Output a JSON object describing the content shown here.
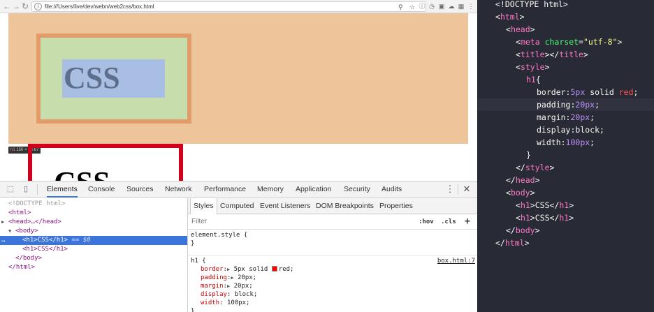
{
  "browser": {
    "url": "file:///Users/live/dev/webn/web2css/box.html",
    "nav": {
      "back": "←",
      "forward": "→",
      "reload": "↻"
    },
    "omnibox_icons": [
      "zoom-icon",
      "star-icon"
    ],
    "toolbar_icons": [
      "info-icon",
      "history-icon",
      "extension-icon",
      "cloud-icon",
      "bookmark-icon",
      "menu-icon"
    ],
    "page": {
      "h1_first": "CSS",
      "h1_second": "CSS",
      "tooltip_tag": "h1",
      "tooltip_dims": "150 × 86.67",
      "colors": {
        "margin": "#eec59a",
        "border": "#e39b6a",
        "padding": "#c7ddab",
        "content": "#a9bee3",
        "h1_border": "#d0021b"
      }
    }
  },
  "devtools": {
    "tabs": [
      "Elements",
      "Console",
      "Sources",
      "Network",
      "Performance",
      "Memory",
      "Application",
      "Security",
      "Audits"
    ],
    "active_tab": "Elements",
    "dom": {
      "doctype": "<!DOCTYPE html>",
      "html_open": "<html>",
      "head": "<head>…</head>",
      "body_open": "<body>",
      "h1_selected_open": "<h1>",
      "h1_selected_text": "CSS",
      "h1_selected_close": "</h1>",
      "selected_marker": "== $0",
      "h1_second": "<h1>CSS</h1>",
      "body_close": "</body>",
      "html_close": "</html>",
      "dots": "…"
    },
    "styles": {
      "tabs": [
        "Styles",
        "Computed",
        "Event Listeners",
        "DOM Breakpoints",
        "Properties"
      ],
      "active_tab": "Styles",
      "filter_placeholder": "Filter",
      "hov": ":hov",
      "cls": ".cls",
      "add": "+",
      "element_style_open": "element.style {",
      "element_style_close": "}",
      "rule_selector": "h1 {",
      "rule_source": "box.html:7",
      "rule_close": "}",
      "declarations": [
        {
          "prop": "border",
          "value": "5px solid",
          "value2": "red;",
          "expandable": true,
          "swatch": true
        },
        {
          "prop": "padding",
          "value": "20px;",
          "expandable": true,
          "swatch": false
        },
        {
          "prop": "margin",
          "value": "20px;",
          "expandable": true,
          "swatch": false
        },
        {
          "prop": "display",
          "value": "block;",
          "expandable": false,
          "swatch": false
        },
        {
          "prop": "width",
          "value": "100px;",
          "expandable": false,
          "swatch": false
        }
      ]
    }
  },
  "editor": {
    "lines": {
      "l1": "<!DOCTYPE html>",
      "l2_tag": "html",
      "l3_tag": "head",
      "l4_tag": "meta",
      "l4_attr": "charset",
      "l4_val": "\"utf-8\"",
      "l5_tag": "title",
      "l5_close": "title",
      "l6_tag": "style",
      "l7_sel": "h1",
      "l7_brace": "{",
      "l8_prop": "border:",
      "l8_num": "5px",
      "l8_rest": "solid",
      "l8_kw": "red",
      "l9_prop": "padding:",
      "l9_num": "20px",
      "l10_prop": "margin:",
      "l10_num": "20px",
      "l11_prop": "display:",
      "l11_val": "block;",
      "l12_prop": "width:",
      "l12_num": "100px",
      "l13": "}",
      "l14_tag": "style",
      "l15_tag": "head",
      "l16_tag": "body",
      "l17_open": "h1",
      "l17_text": "CSS",
      "l17_close": "h1",
      "l18_open": "h1",
      "l18_text": "CSS",
      "l18_close": "h1",
      "l19_tag": "body",
      "l20_tag": "html"
    }
  }
}
